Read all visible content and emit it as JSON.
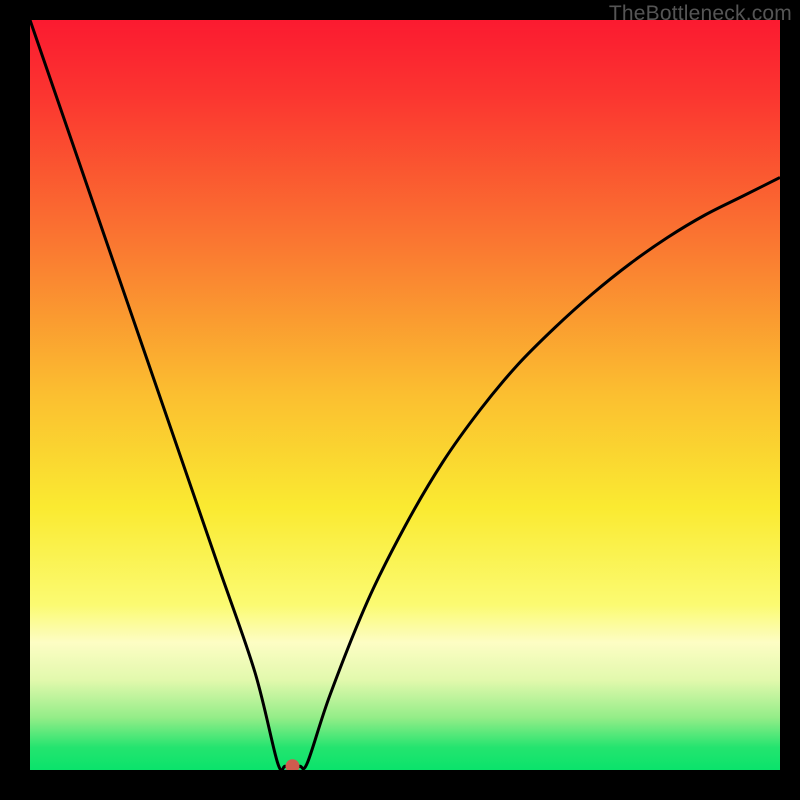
{
  "watermark": "TheBottleneck.com",
  "chart_data": {
    "type": "line",
    "title": "",
    "xlabel": "",
    "ylabel": "",
    "xlim": [
      0,
      100
    ],
    "ylim": [
      0,
      100
    ],
    "grid": false,
    "legend": false,
    "series": [
      {
        "name": "curve",
        "x": [
          0,
          5,
          10,
          15,
          20,
          25,
          30,
          33,
          34,
          35,
          36,
          37,
          40,
          45,
          50,
          55,
          60,
          65,
          70,
          75,
          80,
          85,
          90,
          95,
          100
        ],
        "values": [
          100,
          85.5,
          71,
          56.5,
          42,
          27.5,
          13,
          1,
          0.5,
          0.5,
          0.5,
          1,
          10,
          22.5,
          32.5,
          41,
          48,
          54,
          59,
          63.5,
          67.5,
          71,
          74,
          76.5,
          79
        ]
      }
    ],
    "marker": {
      "x": 35,
      "value": 0.5,
      "color": "#cf5b4e",
      "radius": 7
    },
    "background_gradient": {
      "stops": [
        {
          "offset": 0.0,
          "color": "#fb1a30"
        },
        {
          "offset": 0.1,
          "color": "#fb3530"
        },
        {
          "offset": 0.3,
          "color": "#fa7831"
        },
        {
          "offset": 0.5,
          "color": "#fbbf30"
        },
        {
          "offset": 0.65,
          "color": "#faea31"
        },
        {
          "offset": 0.78,
          "color": "#fbfb72"
        },
        {
          "offset": 0.83,
          "color": "#fdfdc4"
        },
        {
          "offset": 0.88,
          "color": "#e2f9ad"
        },
        {
          "offset": 0.93,
          "color": "#94ed88"
        },
        {
          "offset": 0.97,
          "color": "#24e46f"
        },
        {
          "offset": 1.0,
          "color": "#0ae36b"
        }
      ]
    }
  }
}
